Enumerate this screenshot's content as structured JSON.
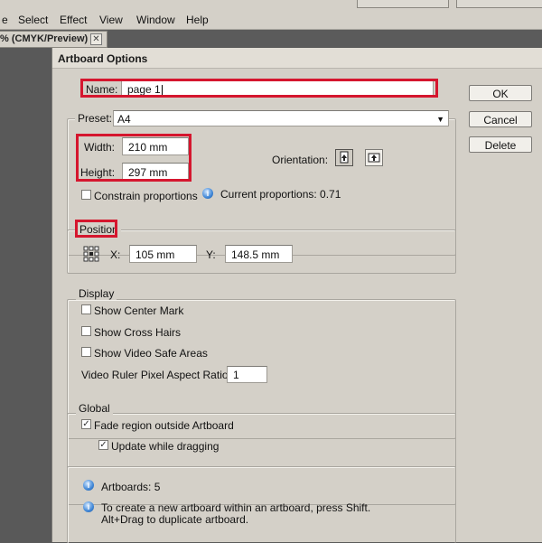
{
  "menubar": {
    "items": [
      "e",
      "Select",
      "Effect",
      "View",
      "Window",
      "Help"
    ]
  },
  "tab": {
    "label": "% (CMYK/Preview)",
    "close_icon": "close-icon"
  },
  "dialog": {
    "title": "Artboard Options",
    "name_label": "Name:",
    "name_value": "page 1",
    "preset_label": "Preset:",
    "preset_value": "A4",
    "width_label": "Width:",
    "width_value": "210 mm",
    "height_label": "Height:",
    "height_value": "297 mm",
    "orientation_label": "Orientation:",
    "orientation_selected": "portrait",
    "constrain_label": "Constrain proportions",
    "constrain_checked": false,
    "current_proportions": "Current proportions: 0.71",
    "position_title": "Position",
    "x_label": "X:",
    "x_value": "105 mm",
    "y_label": "Y:",
    "y_value": "148.5 mm",
    "display_title": "Display",
    "show_center_mark": "Show Center Mark",
    "show_cross_hairs": "Show Cross Hairs",
    "show_video_safe": "Show Video Safe Areas",
    "video_ratio_label": "Video Ruler Pixel Aspect Ratio:",
    "video_ratio_value": "1",
    "global_title": "Global",
    "fade_region": "Fade region outside Artboard",
    "fade_region_checked": true,
    "update_dragging": "Update while dragging",
    "update_dragging_checked": true,
    "artboards_count": "Artboards: 5",
    "info_text_line1": "To create a new artboard within an artboard, press Shift.",
    "info_text_line2": "Alt+Drag to duplicate artboard.",
    "ok": "OK",
    "cancel": "Cancel",
    "delete": "Delete"
  },
  "colors": {
    "highlight": "#d5162e",
    "dialog_bg": "#d4d0c8",
    "workspace_bg": "#595959"
  }
}
